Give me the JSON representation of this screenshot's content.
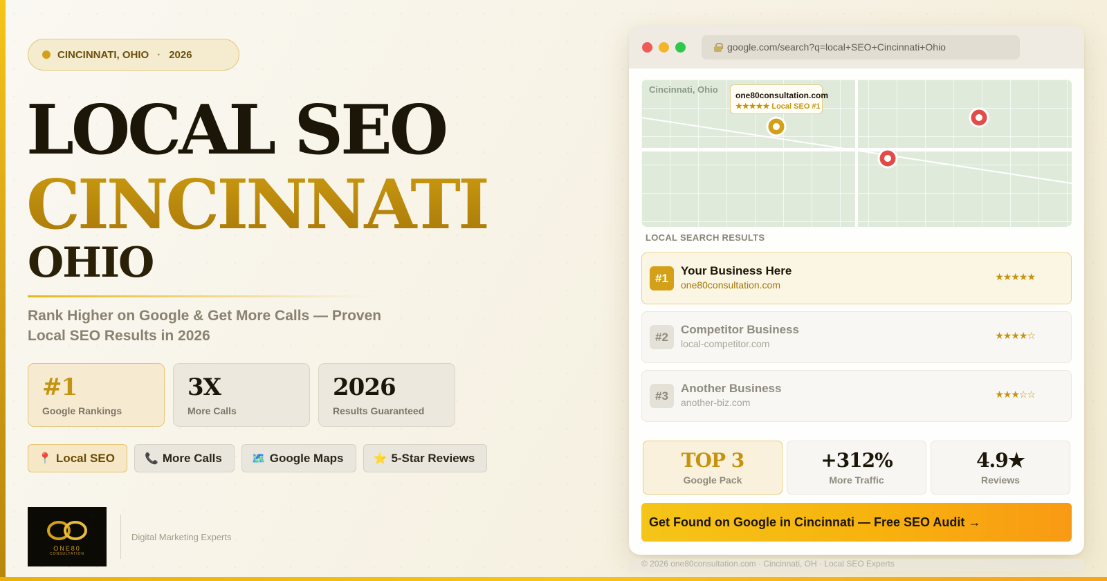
{
  "location_pill": {
    "city": "CINCINNATI, OHIO",
    "sep": "·",
    "year": "2026"
  },
  "headline": {
    "line1": "LOCAL SEO",
    "line2": "CINCINNATI",
    "line3": "OHIO"
  },
  "subheadline": "Rank Higher on Google & Get More Calls — Proven Local SEO Results in 2026",
  "stats": [
    {
      "value": "#1",
      "label": "Google Rankings"
    },
    {
      "value": "3X",
      "label": "More Calls"
    },
    {
      "value": "2026",
      "label": "Results Guaranteed"
    }
  ],
  "tags": [
    {
      "icon": "📍",
      "label": "Local SEO"
    },
    {
      "icon": "📞",
      "label": "More Calls"
    },
    {
      "icon": "🗺️",
      "label": "Google Maps"
    },
    {
      "icon": "⭐",
      "label": "5-Star Reviews"
    }
  ],
  "logo": {
    "name": "ONE80",
    "sub": "CONSULTATION"
  },
  "tagline": "Digital Marketing Experts",
  "browser": {
    "url": "google.com/search?q=local+SEO+Cincinnati+Ohio",
    "map_city": "Cincinnati, Ohio",
    "map_card_site": "one80consultation.com",
    "map_card_rating": "★★★★★  Local SEO #1",
    "results_title": "LOCAL SEARCH RESULTS",
    "results": [
      {
        "rank": "#1",
        "name": "Your Business Here",
        "domain": "one80consultation.com",
        "stars": "★★★★★"
      },
      {
        "rank": "#2",
        "name": "Competitor Business",
        "domain": "local-competitor.com",
        "stars": "★★★★☆"
      },
      {
        "rank": "#3",
        "name": "Another Business",
        "domain": "another-biz.com",
        "stars": "★★★☆☆"
      }
    ],
    "metrics": [
      {
        "value": "TOP 3",
        "label": "Google Pack"
      },
      {
        "value": "+312%",
        "label": "More Traffic"
      },
      {
        "value": "4.9★",
        "label": "Reviews"
      }
    ],
    "cta": "Get Found on Google in Cincinnati — Free SEO Audit →"
  },
  "footer": "© 2026 one80consultation.com  ·  Cincinnati, OH  ·  Local SEO Experts",
  "colors": {
    "accent": "#d4a017",
    "dark": "#1c1608",
    "pin_red": "#e34b47"
  }
}
